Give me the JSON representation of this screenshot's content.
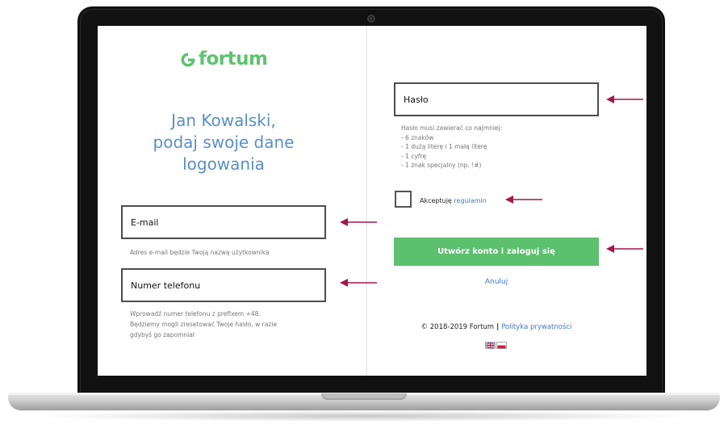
{
  "brand": {
    "name": "fortum",
    "color": "#5cc46e"
  },
  "heading": {
    "lines": [
      "Jan Kowalski,",
      "podaj swoje dane",
      "logowania"
    ],
    "color": "#5b8fc6"
  },
  "email": {
    "placeholder": "E-mail",
    "help": "Adres e-mail będzie Twoją nazwą użytkownika"
  },
  "phone": {
    "placeholder": "Numer telefonu",
    "help_lines": [
      "Wprowadź numer telefonu z prefixem +48.",
      "Będziemy mogli zresetować Twoje hasło, w razie",
      "gdybyś go zapomniał"
    ]
  },
  "password": {
    "placeholder": "Hasło",
    "rules_intro": "Hasło musi zawierać co najmniej:",
    "rules": [
      "- 6 znaków",
      "- 1 dużą literę i 1 małą literę",
      "- 1 cyfrę",
      "- 1 znak specjalny (np. !#)"
    ]
  },
  "terms": {
    "label": "Akceptuję",
    "link": "regulamin",
    "checked": false
  },
  "submit_label": "Utwórz konto i zaloguj się",
  "cancel_label": "Anuluj",
  "footer": {
    "copyright": "© 2018-2019 Fortum",
    "separator": "|",
    "privacy_link": "Polityka prywatności"
  },
  "languages": [
    "en-flag-icon",
    "pl-flag-icon"
  ],
  "colors": {
    "accent_green": "#5dc06f",
    "link_blue": "#3f78c4",
    "arrow": "#a3174a"
  }
}
